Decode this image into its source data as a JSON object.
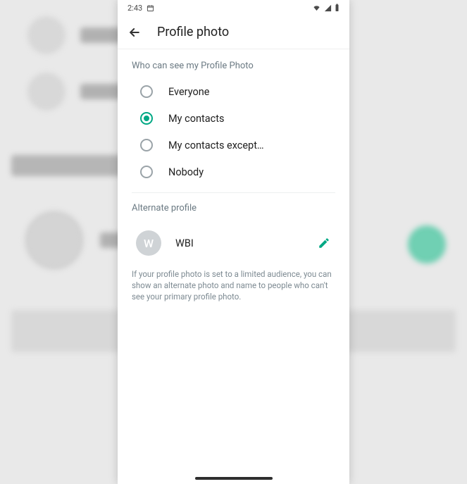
{
  "status": {
    "time": "2:43"
  },
  "appbar": {
    "title": "Profile photo"
  },
  "privacy": {
    "heading": "Who can see my Profile Photo",
    "selected_index": 1,
    "options": [
      {
        "label": "Everyone"
      },
      {
        "label": "My contacts"
      },
      {
        "label": "My contacts except…"
      },
      {
        "label": "Nobody"
      }
    ]
  },
  "alternate": {
    "heading": "Alternate profile",
    "avatar_initial": "W",
    "name": "WBI",
    "help": "If your profile photo is set to a limited audience, you can show an alternate photo and name to people who can't see your primary profile photo."
  },
  "colors": {
    "accent": "#00a884"
  }
}
